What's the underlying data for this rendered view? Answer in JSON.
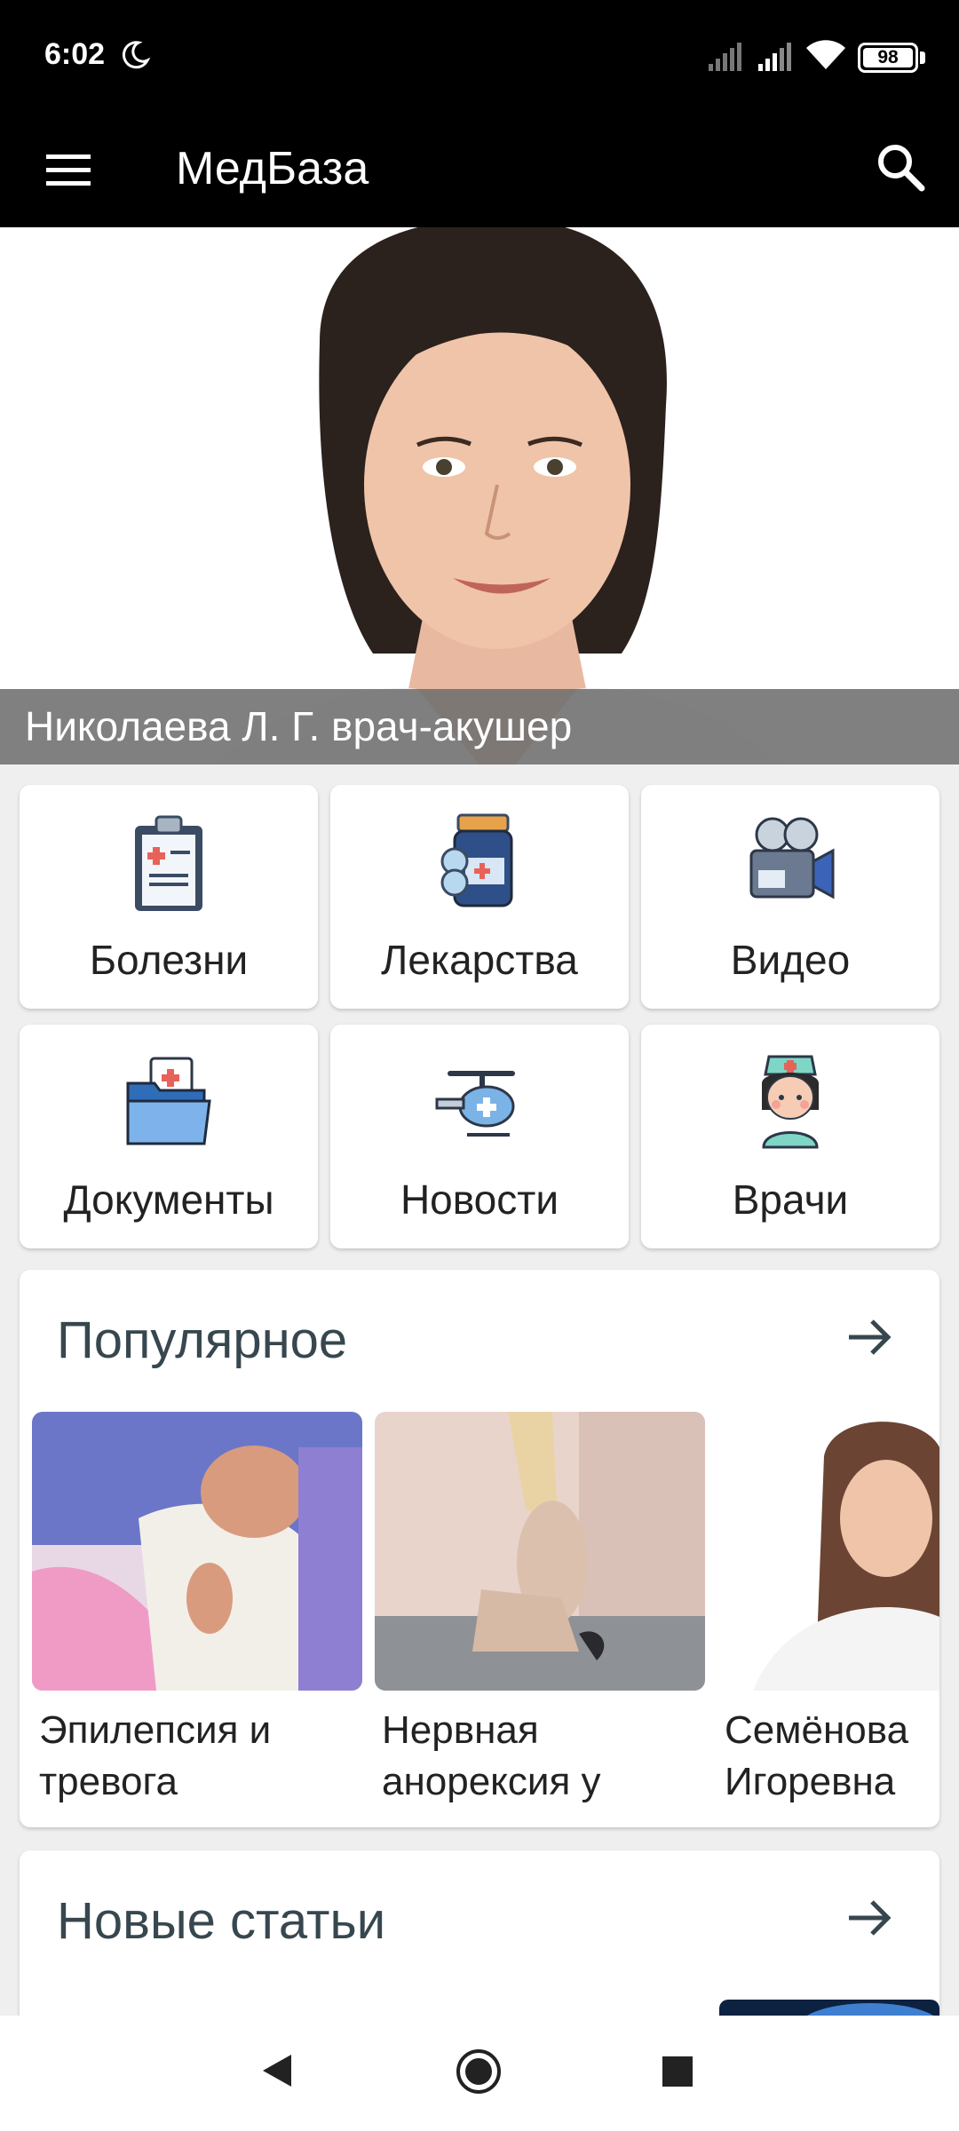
{
  "status_bar": {
    "time": "6:02",
    "battery": "98"
  },
  "app_bar": {
    "title": "МедБаза"
  },
  "hero": {
    "caption": "Николаева Л. Г. врач-акушер"
  },
  "categories": [
    {
      "label": "Болезни",
      "icon": "clipboard-icon"
    },
    {
      "label": "Лекарства",
      "icon": "medicine-jar-icon"
    },
    {
      "label": "Видео",
      "icon": "video-camera-icon"
    },
    {
      "label": "Документы",
      "icon": "folder-icon"
    },
    {
      "label": "Новости",
      "icon": "helicopter-icon"
    },
    {
      "label": "Врачи",
      "icon": "nurse-icon"
    }
  ],
  "popular": {
    "title": "Популярное",
    "items": [
      {
        "text": "Эпилепсия и тревога"
      },
      {
        "text": "Нервная анорексия у"
      },
      {
        "text": "Семёнова Игоревна"
      }
    ]
  },
  "new_articles": {
    "title": "Новые статьи"
  },
  "colors": {
    "bar": "#000000",
    "accent_text": "#37474f",
    "background": "#efefef"
  }
}
